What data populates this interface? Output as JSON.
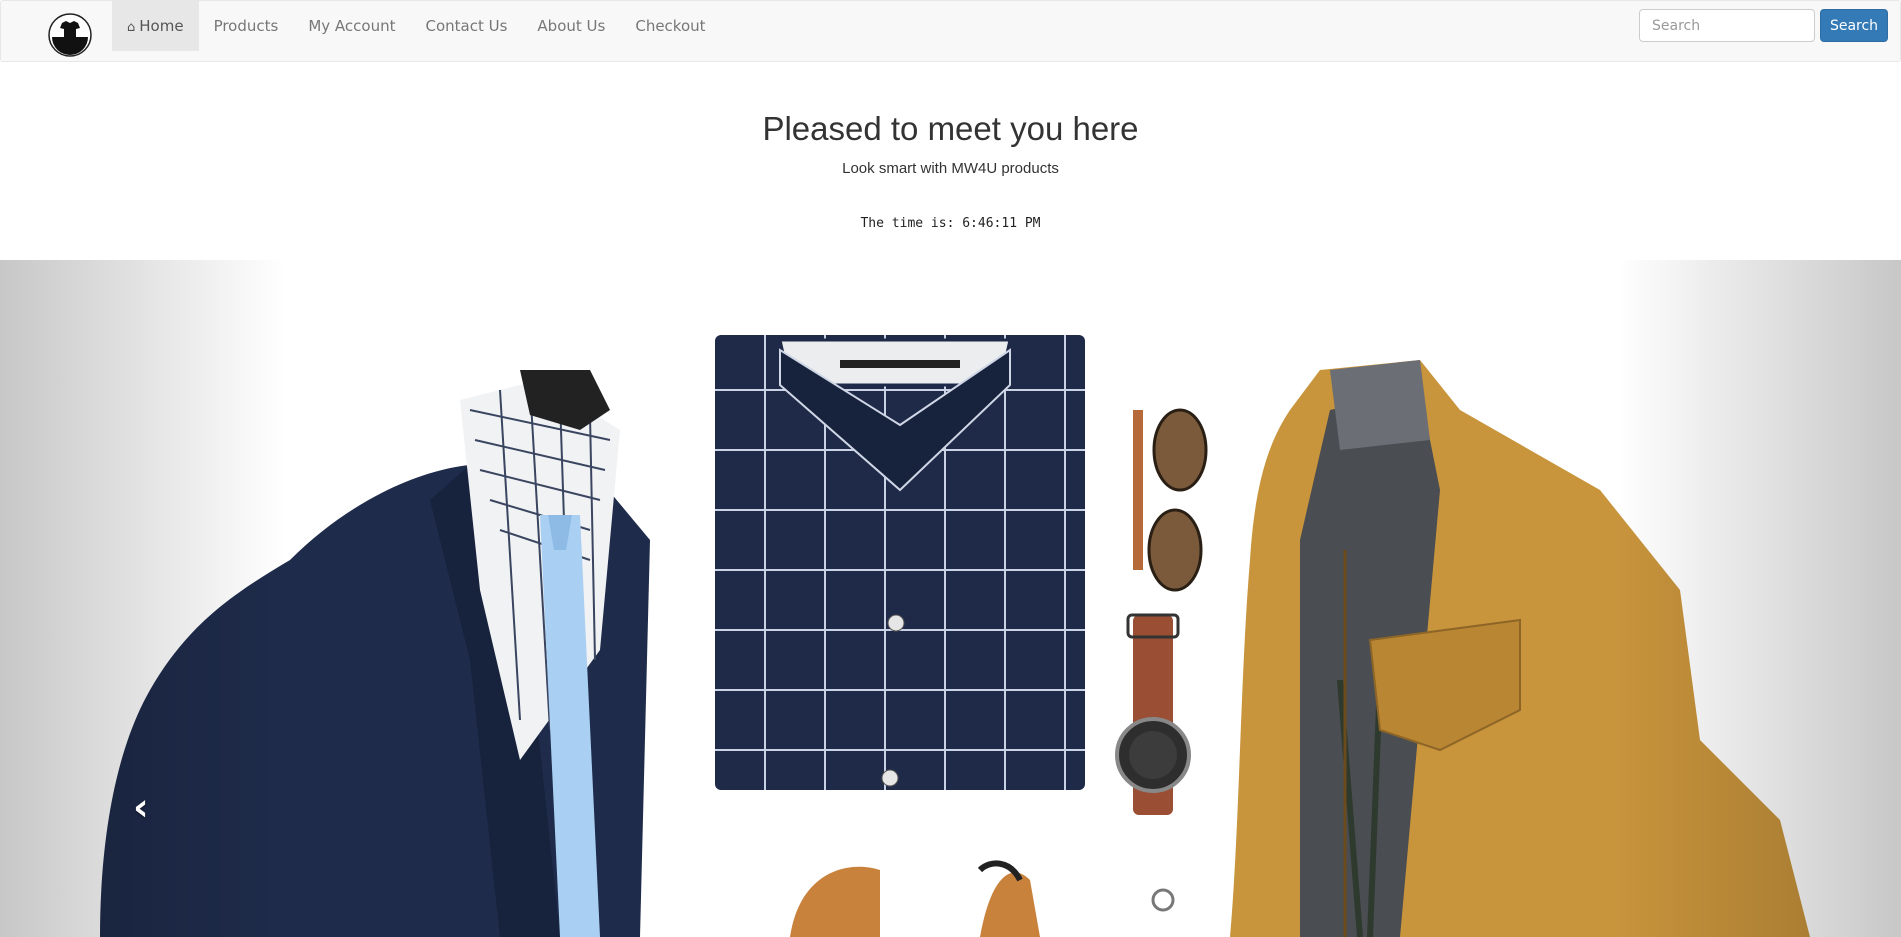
{
  "nav": {
    "items": [
      {
        "label": "Home",
        "icon": "home-icon"
      },
      {
        "label": "Products"
      },
      {
        "label": "My Account"
      },
      {
        "label": "Contact Us"
      },
      {
        "label": "About Us"
      },
      {
        "label": "Checkout"
      }
    ],
    "active_index": 0
  },
  "search": {
    "placeholder": "Search",
    "button_label": "Search"
  },
  "hero": {
    "title": "Pleased to meet you here",
    "subtitle": "Look smart with MW4U products",
    "clock_text": "The time is: 6:46:11 PM"
  },
  "carousel": {
    "prev_icon": "chevron-left-icon",
    "next_icon": "chevron-right-icon"
  },
  "colors": {
    "primary": "#337ab7",
    "navbar_bg": "#f8f8f8",
    "active_nav_bg": "#e7e7e7",
    "navy": "#1e2b4a",
    "tan": "#c8943c"
  }
}
